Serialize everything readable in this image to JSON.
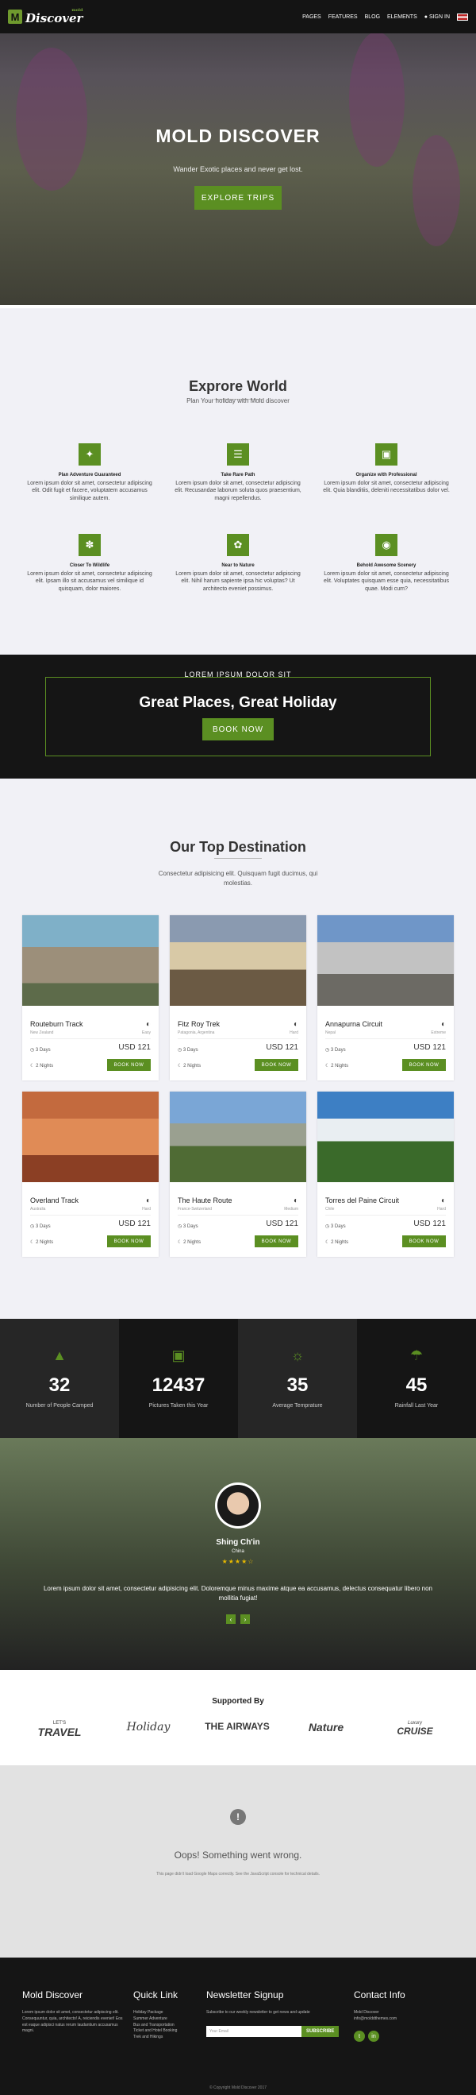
{
  "header": {
    "logo_mark": "M",
    "logo_text": "Discover",
    "logo_small": "mold",
    "nav": [
      "PAGES",
      "FEATURES",
      "BLOG",
      "ELEMENTS"
    ],
    "sign_in": "SIGN IN",
    "flag": "flag-icon"
  },
  "hero": {
    "title": "MOLD DISCOVER",
    "subtitle": "Wander Exotic places and never get lost.",
    "button": "EXPLORE TRIPS"
  },
  "explore": {
    "title": "Exprore World",
    "subtitle": "Plan Your holiday with Mold discover",
    "features": [
      {
        "icon": "adventure-icon",
        "title": "Plan Adventure Guaranteed",
        "text": "Lorem ipsum dolor sit amet, consectetur adipiscing elit. Odit fugit et facere, voluptatem accusamus similique autem."
      },
      {
        "icon": "signpost-icon",
        "title": "Take Rare Path",
        "text": "Lorem ipsum dolor sit amet, consectetur adipiscing elit. Recusandae laborum soluta quos praesentium, magni repellendus."
      },
      {
        "icon": "organize-icon",
        "title": "Organize with Professional",
        "text": "Lorem ipsum dolor sit amet, consectetur adipiscing elit. Quia blanditiis, deleniti necessitatibus dolor vel."
      },
      {
        "icon": "deer-icon",
        "title": "Closer To Wildlife",
        "text": "Lorem ipsum dolor sit amet, consectetur adipiscing elit. Ipsam illo sit accusamus vel similique id quisquam, dolor maiores."
      },
      {
        "icon": "nature-icon",
        "title": "Near to Nature",
        "text": "Lorem ipsum dolor sit amet, consectetur adipiscing elit. Nihil harum sapiente ipsa hic voluptas? Ut architecto eveniet possimus."
      },
      {
        "icon": "binoculars-icon",
        "title": "Behold Awesome Scenery",
        "text": "Lorem ipsum dolor sit amet, consectetur adipiscing elit. Voluptates quisquam esse quia, necessitatibus quae. Modi cum?"
      }
    ]
  },
  "promo": {
    "pre": "LOREM IPSUM DOLOR SIT",
    "title": "Great Places, Great Holiday",
    "button": "BOOK NOW"
  },
  "destinations": {
    "title": "Our Top Destination",
    "subtitle": "Consectetur adipisicing elit. Quisquam fugit ducimus, qui molestias.",
    "cards": [
      {
        "name": "Routeburn Track",
        "location": "New Zealand",
        "difficulty": "Easy",
        "days": "3 Days",
        "nights": "2 Nights",
        "price": "USD 121",
        "button": "BOOK NOW",
        "colors": [
          "#7fb0c8",
          "#9c8f7a",
          "#5d6b4a"
        ]
      },
      {
        "name": "Fitz Roy Trek",
        "location": "Patagonia, Argentina",
        "difficulty": "Hard",
        "days": "3 Days",
        "nights": "2 Nights",
        "price": "USD 121",
        "button": "BOOK NOW",
        "colors": [
          "#8a9ab0",
          "#d8c9a6",
          "#6b5a44"
        ]
      },
      {
        "name": "Annapurna Circuit",
        "location": "Nepal",
        "difficulty": "Extreme",
        "days": "3 Days",
        "nights": "2 Nights",
        "price": "USD 121",
        "button": "BOOK NOW",
        "colors": [
          "#6f96c8",
          "#c2c2c2",
          "#6c6a64"
        ]
      },
      {
        "name": "Overland Track",
        "location": "Australia",
        "difficulty": "Hard",
        "days": "3 Days",
        "nights": "2 Nights",
        "price": "USD 121",
        "button": "BOOK NOW",
        "colors": [
          "#c36a3e",
          "#e08b56",
          "#8b3f24"
        ]
      },
      {
        "name": "The Haute Route",
        "location": "France-Switzerland",
        "difficulty": "Medium",
        "days": "3 Days",
        "nights": "2 Nights",
        "price": "USD 121",
        "button": "BOOK NOW",
        "colors": [
          "#7aa6d6",
          "#9aa090",
          "#4f6b34"
        ]
      },
      {
        "name": "Torres del Paine Circuit",
        "location": "Chile",
        "difficulty": "Hard",
        "days": "3 Days",
        "nights": "2 Nights",
        "price": "USD 121",
        "button": "BOOK NOW",
        "colors": [
          "#3d7fc4",
          "#e9eef2",
          "#3a6a2a"
        ]
      }
    ]
  },
  "stats": [
    {
      "icon": "tent-icon",
      "number": "32",
      "label": "Number of People Camped",
      "bg": "#262626"
    },
    {
      "icon": "camera-icon",
      "number": "12437",
      "label": "Pictures Taken this Year",
      "bg": "#151515"
    },
    {
      "icon": "sun-icon",
      "number": "35",
      "label": "Average Temprature",
      "bg": "#262626"
    },
    {
      "icon": "umbrella-icon",
      "number": "45",
      "label": "Rainfall Last Year",
      "bg": "#151515"
    }
  ],
  "testimonial": {
    "name": "Shing Ch'in",
    "country": "China",
    "stars": "★★★★☆",
    "quote": "Lorem ipsum dolor sit amet, consectetur adipisicing elit. Doloremque minus maxime atque ea accusamus, delectus consequatur libero non mollitia fugiat!"
  },
  "supported": {
    "title": "Supported By",
    "sponsors": [
      {
        "top": "LET'S",
        "name": "TRAVEL"
      },
      {
        "top": "",
        "name": "Holiday"
      },
      {
        "top": "",
        "name": "THE AIRWAYS"
      },
      {
        "top": "",
        "name": "Nature"
      },
      {
        "top": "Luxury",
        "name": "CRUISE"
      }
    ]
  },
  "map": {
    "icon": "!",
    "title": "Oops! Something went wrong.",
    "subtitle": "This page didn't load Google Maps correctly. See the JavaScript console for technical details."
  },
  "footer": {
    "about": {
      "title": "Mold Discover",
      "text": "Lorem ipsum dolor sit amet, consectetur adipiscing elit. Consequuntur, quia, architecto! A, reiciendis eveniet! Eos est eaque adipisci natus rerum laudantium accusamus magni."
    },
    "links": {
      "title": "Quick Link",
      "items": [
        "Holiday Package",
        "Summer Adventure",
        "Bus and Transportation",
        "Ticket and Hotel Booking",
        "Trek and Hikings"
      ]
    },
    "newsletter": {
      "title": "Newsletter Signup",
      "text": "Subscribe to our weekly newsletter to get news and update",
      "placeholder": "Your Email",
      "button": "SUBSCRIBE"
    },
    "contact": {
      "title": "Contact Info",
      "name": "Mold Discover",
      "email": "info@molddthemes.com"
    },
    "copyright": "© Copyright Mold Discover 2017"
  }
}
